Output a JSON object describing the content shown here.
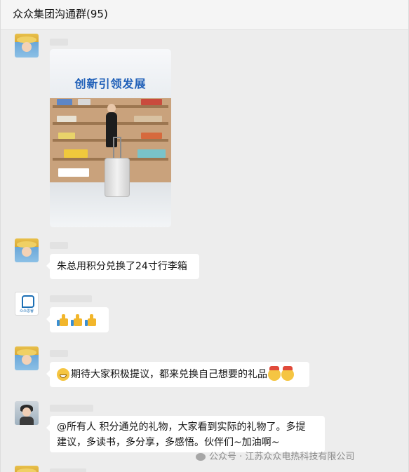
{
  "header": {
    "title": "众众集团沟通群(95)"
  },
  "photo": {
    "banner_text": "创新引领发展"
  },
  "messages": [
    {
      "text": "朱总用积分兑换了24寸行李箱"
    },
    {
      "text": "👍👍👍"
    },
    {
      "text": "期待大家积极提议，都来兑换自己想要的礼品"
    },
    {
      "line1": "@所有人 积分通兑的礼物，大家看到实际的礼物了。多提",
      "line2": "建议，多读书，多分享，多感悟。伙伴们~加油啊~"
    }
  ],
  "avatar_logo_text": "众众思睿",
  "watermark": {
    "text": "公众号 · 江苏众众电热科技有限公司"
  }
}
